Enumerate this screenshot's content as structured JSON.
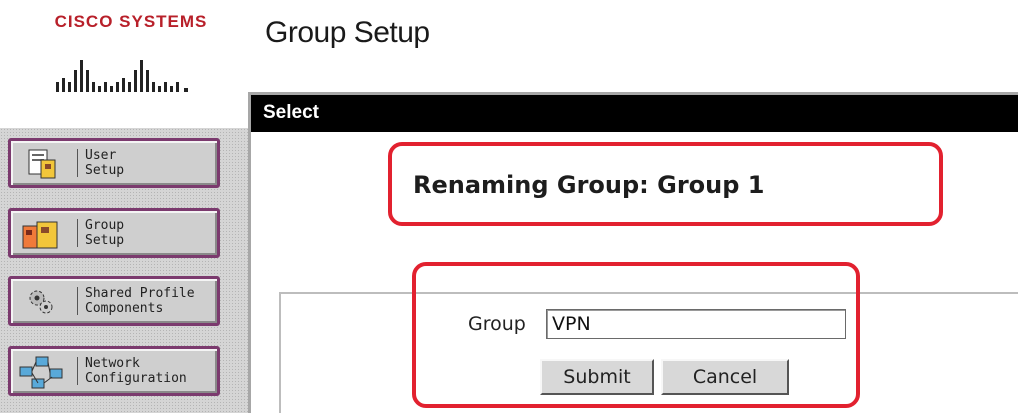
{
  "brand": {
    "name": "Cisco Systems",
    "wordmark": "CISCO SYSTEMS",
    "color": "#b8202a"
  },
  "page": {
    "title": "Group Setup"
  },
  "header_bar": {
    "label": "Select"
  },
  "sidebar": {
    "items": [
      {
        "label": "User\nSetup",
        "icon": "user-setup-icon"
      },
      {
        "label": "Group\nSetup",
        "icon": "group-setup-icon"
      },
      {
        "label": "Shared Profile\nComponents",
        "icon": "shared-profile-icon"
      },
      {
        "label": "Network\nConfiguration",
        "icon": "network-config-icon"
      }
    ]
  },
  "main": {
    "heading": "Renaming Group: Group 1",
    "form": {
      "field_label": "Group",
      "field_value": "VPN",
      "submit_label": "Submit",
      "cancel_label": "Cancel"
    }
  },
  "colors": {
    "highlight": "#e2212f",
    "header_bg": "#000000",
    "nav_border": "#7b3a6e"
  }
}
